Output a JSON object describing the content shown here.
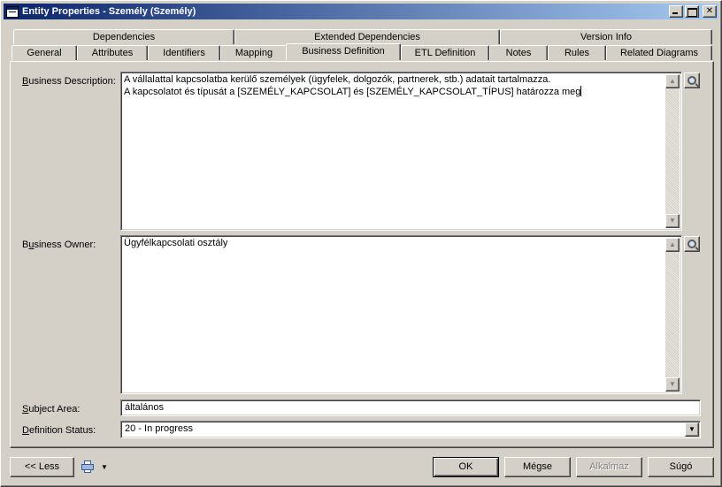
{
  "window": {
    "title": "Entity Properties - Személy (Személy)"
  },
  "tabs_row1": [
    {
      "label": "Dependencies"
    },
    {
      "label": "Extended Dependencies"
    },
    {
      "label": "Version Info"
    }
  ],
  "tabs_row2": [
    {
      "label": "General"
    },
    {
      "label": "Attributes"
    },
    {
      "label": "Identifiers"
    },
    {
      "label": "Mapping"
    },
    {
      "label": "Business Definition"
    },
    {
      "label": "ETL Definition"
    },
    {
      "label": "Notes"
    },
    {
      "label": "Rules"
    },
    {
      "label": "Related Diagrams"
    }
  ],
  "active_tab": "Business Definition",
  "fields": {
    "business_description": {
      "label_prefix": "",
      "label_mnemonic": "B",
      "label_rest": "usiness Description:",
      "value_line1": "A vállalattal kapcsolatba kerülő személyek (ügyfelek, dolgozók, partnerek, stb.) adatait tartalmazza.",
      "value_line2": "A kapcsolatot és típusát a [SZEMÉLY_KAPCSOLAT] és [SZEMÉLY_KAPCSOLAT_TÍPUS] határozza meg"
    },
    "business_owner": {
      "label_prefix": "B",
      "label_mnemonic": "u",
      "label_rest": "siness Owner:",
      "value": "Ügyfélkapcsolati osztály"
    },
    "subject_area": {
      "label_prefix": "",
      "label_mnemonic": "S",
      "label_rest": "ubject Area:",
      "value": "általános"
    },
    "definition_status": {
      "label_prefix": "",
      "label_mnemonic": "D",
      "label_rest": "efinition Status:",
      "value": "20 - In progress"
    }
  },
  "buttons": {
    "less": "<< Less",
    "ok": "OK",
    "cancel": "Mégse",
    "apply": "Alkalmaz",
    "help": "Súgó"
  },
  "icons": {
    "zoom": "magnifier-icon",
    "print": "printer-icon"
  }
}
